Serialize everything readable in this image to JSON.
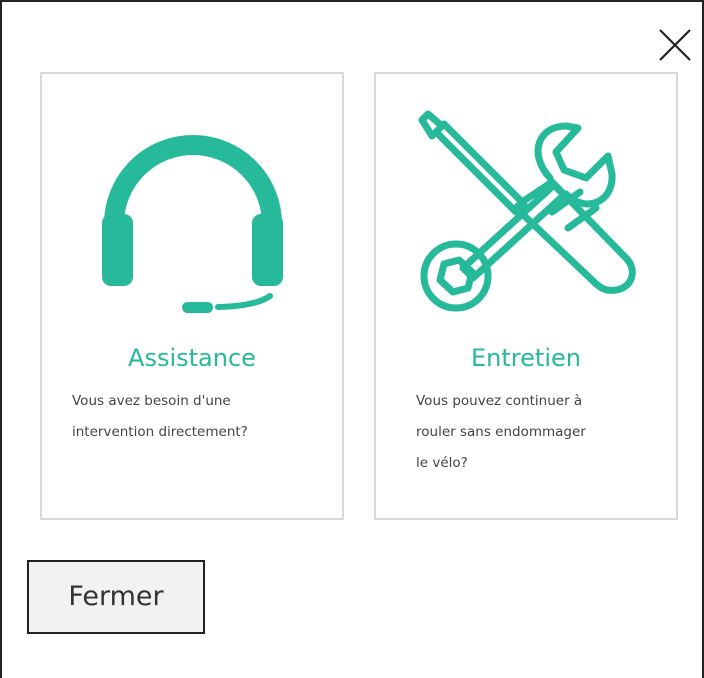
{
  "accent_color": "#26b99a",
  "dialog": {
    "close_icon": "close-icon"
  },
  "cards": [
    {
      "icon": "headset-icon",
      "title": "Assistance",
      "desc_lines": [
        "Vous avez besoin d'une",
        "intervention directement?"
      ]
    },
    {
      "icon": "tools-icon",
      "title": "Entretien",
      "desc_lines": [
        "Vous pouvez continuer à",
        "rouler sans endommager",
        "le vélo?"
      ]
    }
  ],
  "footer": {
    "close_label": "Fermer"
  }
}
